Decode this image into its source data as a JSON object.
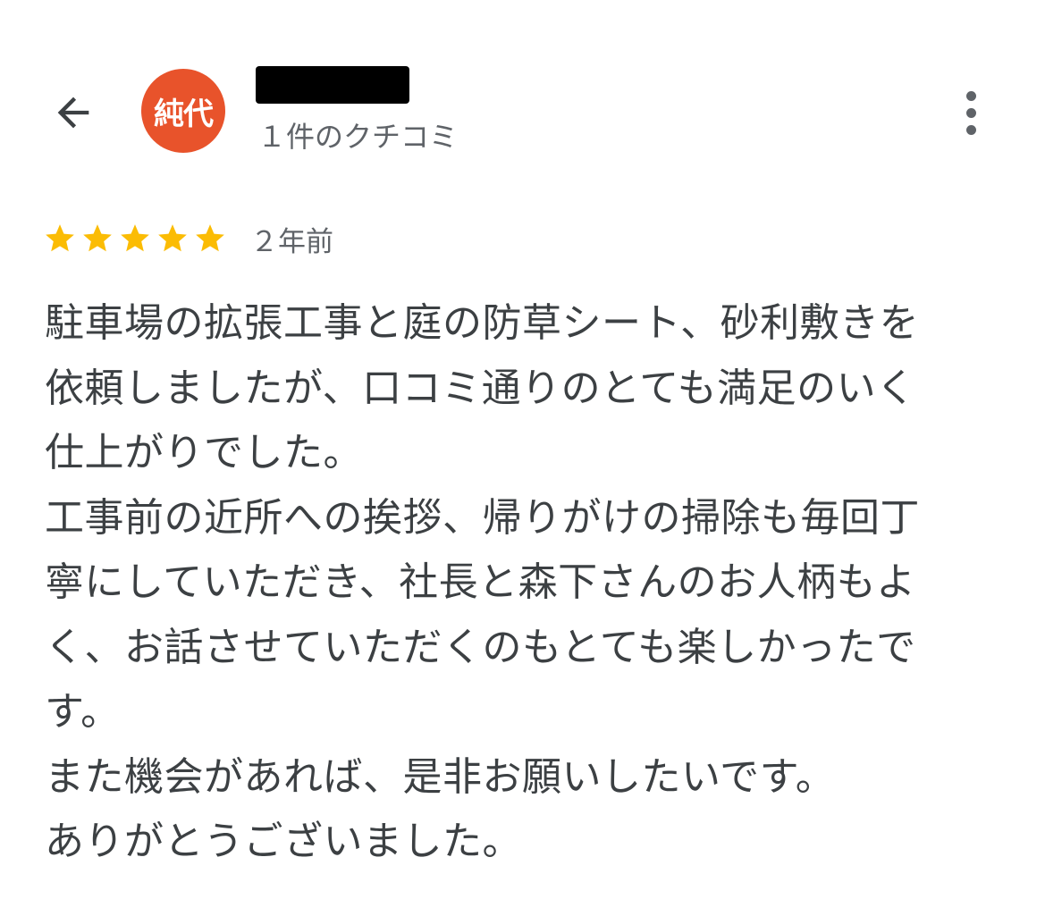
{
  "header": {
    "back_icon": "arrow-left-icon",
    "avatar_text": "純代",
    "avatar_color": "#e8532b",
    "review_count_text": "１件のクチコミ",
    "menu_icon": "more-vert-icon"
  },
  "review": {
    "rating": 5,
    "rating_max": 5,
    "star_color": "#fbbc04",
    "time_ago": "２年前",
    "lines": [
      "駐車場の拡張工事と庭の防草シート、砂利敷きを",
      "依頼しましたが、口コミ通りのとても満足のいく",
      "仕上がりでした。",
      "工事前の近所への挨拶、帰りがけの掃除も毎回丁",
      "寧にしていただき、社長と森下さんのお人柄もよ",
      "く、お話させていただくのもとても楽しかったで",
      "す。",
      "また機会があれば、是非お願いしたいです。",
      "ありがとうございました。"
    ]
  }
}
